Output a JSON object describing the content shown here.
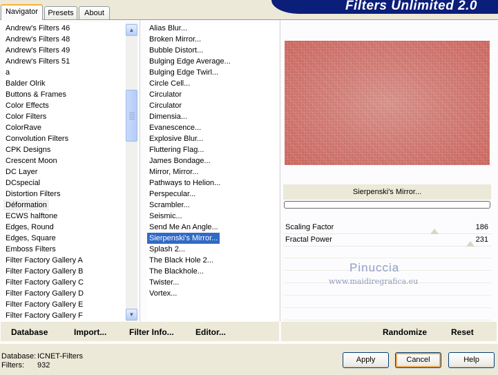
{
  "app": {
    "title": "Filters Unlimited 2.0"
  },
  "tabs": [
    {
      "label": "Navigator",
      "active": true
    },
    {
      "label": "Presets",
      "active": false
    },
    {
      "label": "About",
      "active": false
    }
  ],
  "categories": [
    "Andrew's Filters 46",
    "Andrew's Filters 48",
    "Andrew's Filters 49",
    "Andrew's Filters 51",
    "a",
    "Balder Olrik",
    "Buttons & Frames",
    "Color Effects",
    "Color Filters",
    "ColorRave",
    "Convolution Filters",
    "CPK Designs",
    "Crescent Moon",
    "DC Layer",
    "DCspecial",
    "Distortion Filters",
    "Déformation",
    "ECWS halftone",
    "Edges, Round",
    "Edges, Square",
    "Emboss Filters",
    "Filter Factory Gallery A",
    "Filter Factory Gallery B",
    "Filter Factory Gallery C",
    "Filter Factory Gallery D",
    "Filter Factory Gallery E",
    "Filter Factory Gallery F"
  ],
  "selected_category_index": 16,
  "filters": [
    "Alias Blur...",
    "Broken Mirror...",
    "Bubble Distort...",
    "Bulging Edge Average...",
    "Bulging Edge Twirl...",
    "Circle Cell...",
    "Circulator",
    "Circulator",
    "Dimensia...",
    "Evanescence...",
    "Explosive Blur...",
    "Fluttering Flag...",
    "James Bondage...",
    "Mirror, Mirror...",
    "Pathways to Helion...",
    "Perspecular...",
    "Scrambler...",
    "Seismic...",
    "Send Me An Angle...",
    "Sierpenski's Mirror...",
    "Splash 2...",
    "The Black Hole 2...",
    "The Blackhole...",
    "Twister...",
    "Vortex..."
  ],
  "selected_filter_index": 19,
  "current_filter_name": "Sierpenski's Mirror...",
  "parameters": [
    {
      "label": "Scaling Factor",
      "value": "186"
    },
    {
      "label": "Fractal Power",
      "value": "231"
    }
  ],
  "watermark": {
    "name": "Pinuccia",
    "url": "www.maidiregrafica.eu"
  },
  "bottom_links": {
    "database": "Database",
    "import": "Import...",
    "filter_info": "Filter Info...",
    "editor": "Editor...",
    "randomize": "Randomize",
    "reset": "Reset"
  },
  "status": {
    "database_label": "Database:",
    "database_value": "ICNET-Filters",
    "filters_label": "Filters:",
    "filters_value": "932"
  },
  "buttons": {
    "apply": "Apply",
    "cancel": "Cancel",
    "help": "Help"
  },
  "colors": {
    "title_banner": "#0a1e7a",
    "selection": "#316ac5",
    "preview_base": "#cf7a73"
  }
}
